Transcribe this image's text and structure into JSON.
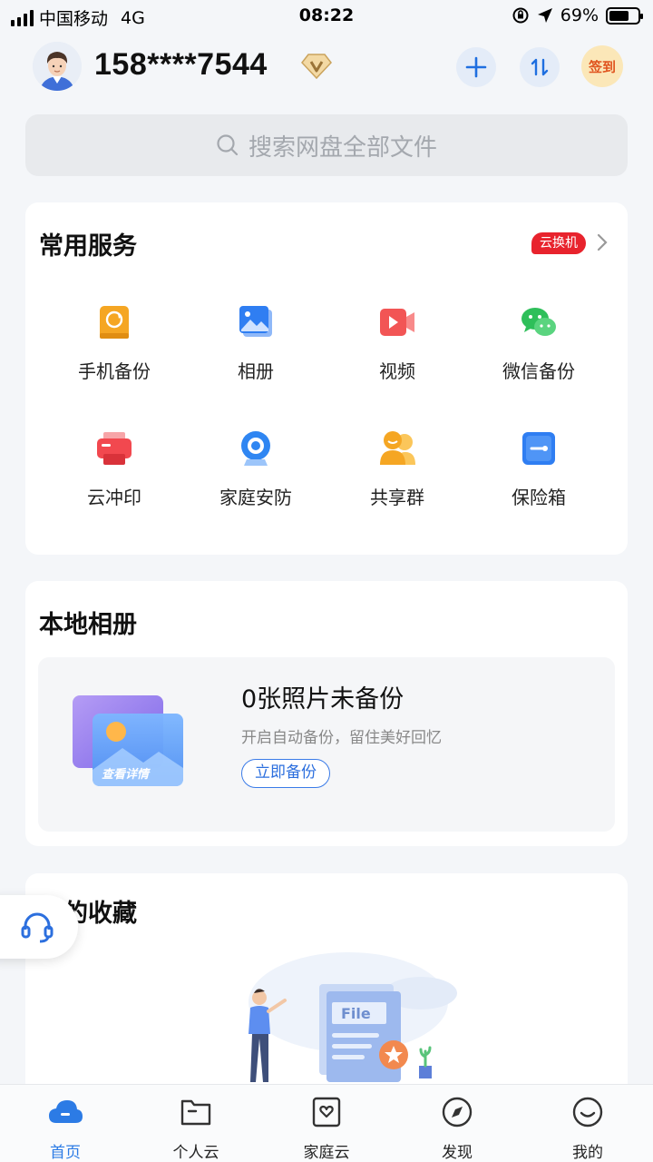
{
  "status_bar": {
    "carrier": "中国移动",
    "network": "4G",
    "time": "08:22",
    "battery_percent": "69%",
    "battery_level": 0.69
  },
  "header": {
    "phone": "158****7544",
    "checkin_label": "签到"
  },
  "search": {
    "placeholder": "搜索网盘全部文件"
  },
  "services": {
    "title": "常用服务",
    "promo_badge": "云换机",
    "items": [
      {
        "label": "手机备份",
        "icon": "phone-backup-icon",
        "color": "#f5a623"
      },
      {
        "label": "相册",
        "icon": "album-icon",
        "color": "#2f7ef2"
      },
      {
        "label": "视频",
        "icon": "video-icon",
        "color": "#f25555"
      },
      {
        "label": "微信备份",
        "icon": "wechat-icon",
        "color": "#2ebf5a"
      },
      {
        "label": "云冲印",
        "icon": "print-icon",
        "color": "#f2484f"
      },
      {
        "label": "家庭安防",
        "icon": "camera-icon",
        "color": "#2f86f2"
      },
      {
        "label": "共享群",
        "icon": "share-group-icon",
        "color": "#f5a623"
      },
      {
        "label": "保险箱",
        "icon": "safe-icon",
        "color": "#2f7ef2"
      }
    ]
  },
  "local_album": {
    "title": "本地相册",
    "count_text": "0张照片未备份",
    "subtitle": "开启自动备份，留住美好回忆",
    "backup_button": "立即备份",
    "illustration_label": "查看详情"
  },
  "favorites": {
    "title": "我的收藏",
    "illustration_label": "File"
  },
  "tabbar": {
    "tabs": [
      {
        "label": "首页",
        "active": true
      },
      {
        "label": "个人云",
        "active": false
      },
      {
        "label": "家庭云",
        "active": false
      },
      {
        "label": "发现",
        "active": false
      },
      {
        "label": "我的",
        "active": false
      }
    ]
  },
  "colors": {
    "accent": "#2c7be5",
    "promo": "#e8232d",
    "background": "#f4f6f9"
  }
}
